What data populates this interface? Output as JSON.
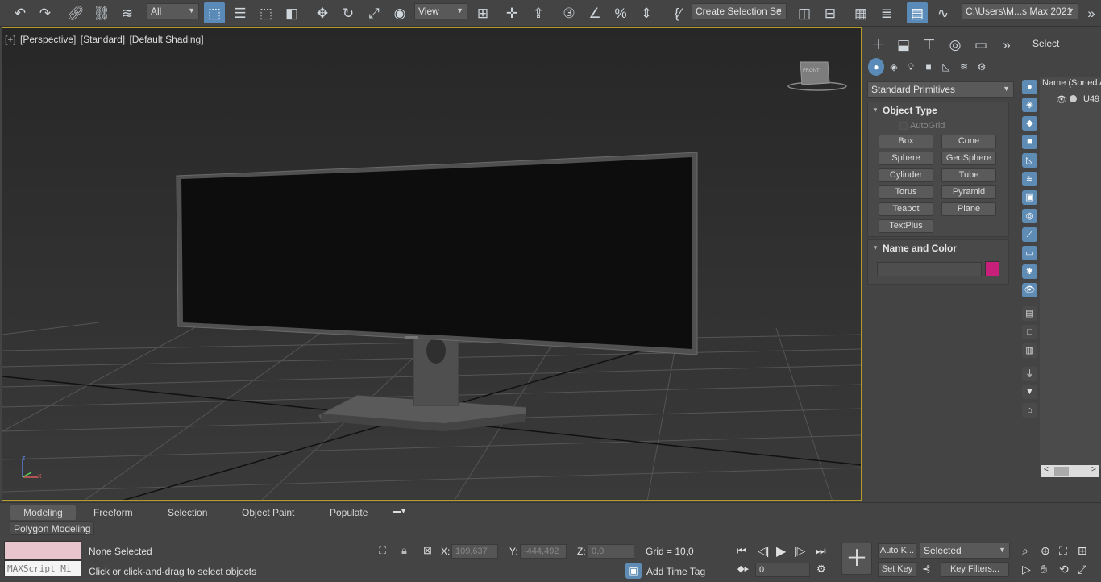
{
  "toolbar": {
    "selection_filter": "All",
    "ref_coord": "View",
    "selection_set_placeholder": "Create Selection Se",
    "project_path": "C:\\Users\\M...s Max 2021"
  },
  "viewport": {
    "label_plus": "[+]",
    "label_view": "[Perspective]",
    "label_standard": "[Standard]",
    "label_shading": "[Default Shading]",
    "viewcube_text": "FRONT",
    "axis_z": "z",
    "axis_x": "x"
  },
  "command_panel": {
    "category": "Standard Primitives",
    "object_type_title": "Object Type",
    "autogrid_label": "AutoGrid",
    "primitives": [
      "Box",
      "Cone",
      "Sphere",
      "GeoSphere",
      "Cylinder",
      "Tube",
      "Torus",
      "Pyramid",
      "Teapot",
      "Plane",
      "TextPlus"
    ],
    "name_color_title": "Name and Color",
    "object_color": "#c81f7a"
  },
  "scene_explorer": {
    "select_label": "Select",
    "column_header": "Name (Sorted A",
    "item": "U49"
  },
  "ribbon": {
    "tabs": [
      "Modeling",
      "Freeform",
      "Selection",
      "Object Paint",
      "Populate"
    ],
    "subtab": "Polygon Modeling"
  },
  "status": {
    "maxscript_placeholder": "MAXScript Mi",
    "selection_status": "None Selected",
    "prompt": "Click or click-and-drag to select objects",
    "x_label": "X:",
    "x_value": "109,637",
    "y_label": "Y:",
    "y_value": "-444,492",
    "z_label": "Z:",
    "z_value": "0,0",
    "grid": "Grid = 10,0",
    "add_time_tag": "Add Time Tag",
    "frame_value": "0",
    "auto_key": "Auto K...",
    "set_key": "Set Key",
    "key_mode": "Selected",
    "key_filters": "Key Filters..."
  },
  "colors": {
    "accent": "#5a8bb8",
    "viewport_border": "#b49a2a",
    "viewport_bg": "#2b2b2b"
  }
}
